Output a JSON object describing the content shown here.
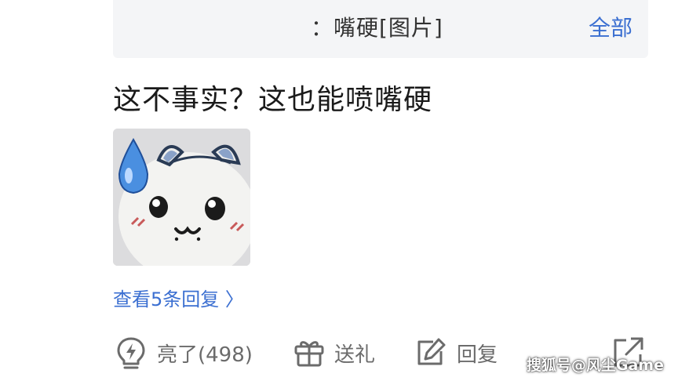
{
  "quote": {
    "text": "：嘴硬[图片]",
    "all_label": "全部"
  },
  "comment": {
    "text": "这不事实？这也能喷嘴硬",
    "image_icon": "hamster-sweat-sticker-icon"
  },
  "replies": {
    "view_label": "查看5条回复 〉"
  },
  "actions": {
    "like": {
      "icon": "lightbulb-icon",
      "label": "亮了(498)"
    },
    "gift": {
      "icon": "gift-icon",
      "label": "送礼"
    },
    "reply": {
      "icon": "edit-icon",
      "label": "回复"
    },
    "share": {
      "icon": "share-icon"
    }
  },
  "watermark": "搜狐号@风尘Game",
  "colors": {
    "accent": "#3b6fd1",
    "quote_bg": "#f4f5f7",
    "action_gray": "#6b6b6b"
  }
}
